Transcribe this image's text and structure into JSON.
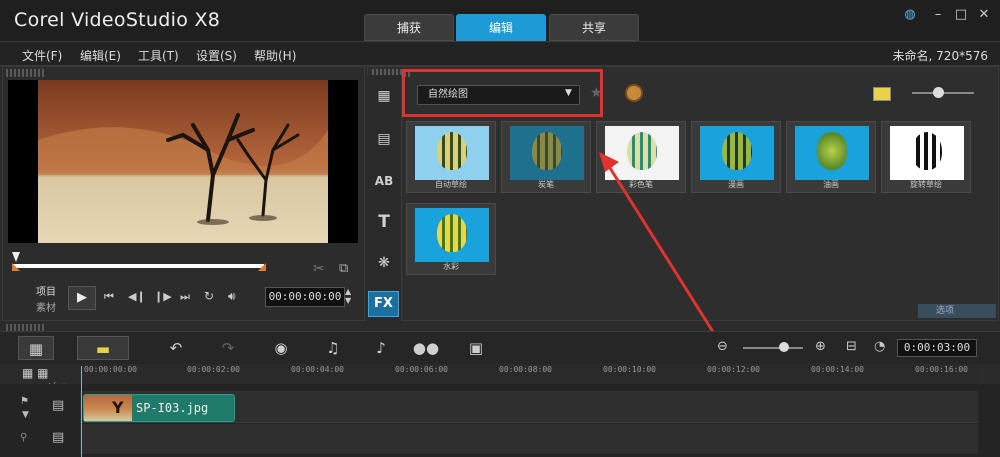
{
  "app": {
    "title": "Corel VideoStudio X8"
  },
  "tabs": [
    "捕获",
    "编辑",
    "共享"
  ],
  "active_tab": "编辑",
  "menu": [
    "文件(F)",
    "编辑(E)",
    "工具(T)",
    "设置(S)",
    "帮助(H)"
  ],
  "project_info": "未命名, 720*576",
  "player": {
    "project_label": "项目",
    "clip_label": "素材",
    "timecode": "00:00:00:00"
  },
  "library": {
    "filter_selected": "自然绘图",
    "options_label": "选项",
    "thumbnails": [
      {
        "label": "自动草绘",
        "bg": "#8fd0ef"
      },
      {
        "label": "炭笔",
        "bg": "#1f6f8e"
      },
      {
        "label": "彩色笔",
        "bg": "#f3f3f3"
      },
      {
        "label": "漫画",
        "bg": "#1aa2dc"
      },
      {
        "label": "油画",
        "bg": "#1aa2dc"
      },
      {
        "label": "旋转草绘",
        "bg": "#ffffff"
      },
      {
        "label": "水彩",
        "bg": "#1aa2dc"
      }
    ]
  },
  "timeline": {
    "timecode": "0:00:03:00",
    "ruler": [
      "00:00:00:00",
      "00:00:02:00",
      "00:00:04:00",
      "00:00:06:00",
      "00:00:08:00",
      "00:00:10:00",
      "00:00:12:00",
      "00:00:14:00",
      "00:00:16:00"
    ],
    "clip_name": "SP-I03.jpg"
  },
  "colors": {
    "accent": "#1e9bd7",
    "highlight": "#e0332f",
    "clip": "#1f7a6a"
  }
}
